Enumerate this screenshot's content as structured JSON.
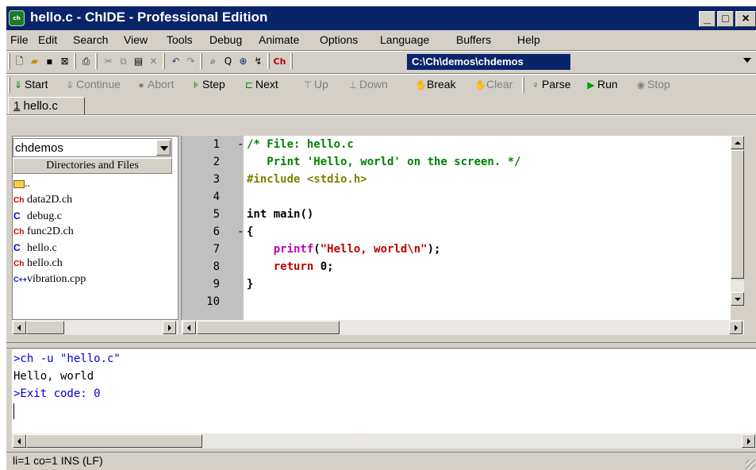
{
  "window": {
    "title": "hello.c - ChIDE - Professional Edition",
    "icon_text": "ch",
    "minimize_glyph": "_",
    "maximize_glyph": "□",
    "close_glyph": "×"
  },
  "menu": [
    "File",
    "Edit",
    "Search",
    "View",
    "Tools",
    "Debug",
    "Animate",
    "Options",
    "Language",
    "Buffers",
    "Help"
  ],
  "toolbar": {
    "ch_label": "Ch",
    "path": "C:\\Ch\\demos\\chdemos"
  },
  "debug_toolbar": {
    "start": "Start",
    "continue": "Continue",
    "abort": "Abort",
    "step": "Step",
    "next": "Next",
    "up": "Up",
    "down": "Down",
    "break": "Break",
    "clear": "Clear",
    "parse": "Parse",
    "run": "Run",
    "stop": "Stop"
  },
  "tab": {
    "number": "1",
    "label": " hello.c"
  },
  "file_browser": {
    "directory": "chdemos",
    "header": "Directories and Files",
    "parent": "..",
    "files": [
      {
        "badge": "Ch",
        "name": "data2D.ch"
      },
      {
        "badge": "C",
        "name": "debug.c"
      },
      {
        "badge": "Ch",
        "name": "func2D.ch"
      },
      {
        "badge": "C",
        "name": "hello.c"
      },
      {
        "badge": "Ch",
        "name": "hello.ch"
      },
      {
        "badge": "C++",
        "name": "vibration.cpp"
      }
    ]
  },
  "editor": {
    "line_numbers": [
      "1",
      "2",
      "3",
      "4",
      "5",
      "6",
      "7",
      "8",
      "9",
      "10"
    ],
    "fold_markers": {
      "l1": "-",
      "l6": "-"
    },
    "code": {
      "l1": "/* File: hello.c",
      "l2": "   Print 'Hello, world' on the screen. */",
      "l3": "#include <stdio.h>",
      "l5_kw": "int",
      "l5_rest": " main()",
      "l6": "{",
      "l7_indent": "    ",
      "l7_fn": "printf",
      "l7_paren": "(",
      "l7_str": "\"Hello, world\\n\"",
      "l7_end": ");",
      "l8_indent": "    ",
      "l8_kw": "return",
      "l8_num": " 0",
      "l8_end": ";",
      "l9": "}"
    }
  },
  "output": {
    "lines": [
      ">ch -u \"hello.c\"",
      "Hello, world",
      ">Exit code: 0"
    ]
  },
  "status_bar": "li=1 co=1 INS (LF)",
  "colors": {
    "title_bar": "#0a246a",
    "comment": "#008000",
    "preprocessor": "#808000",
    "function": "#c000c0",
    "string": "#c00000",
    "output_command": "#0000cc"
  }
}
